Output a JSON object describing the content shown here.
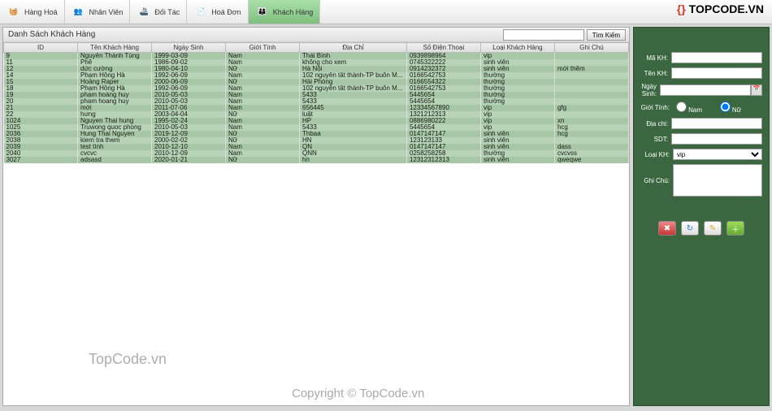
{
  "toolbar": {
    "items": [
      {
        "label": "Hàng Hoá",
        "icon": "🧺"
      },
      {
        "label": "Nhân Viên",
        "icon": "👥"
      },
      {
        "label": "Đối Tác",
        "icon": "🚢"
      },
      {
        "label": "Hoá Đơn",
        "icon": "📄"
      },
      {
        "label": "Khách Hàng",
        "icon": "👨‍👩‍👦"
      }
    ]
  },
  "logo_text": "TOPCODE.VN",
  "list_title": "Danh Sách Khách Hàng",
  "search_btn": "Tìm Kiếm",
  "columns": [
    "ID",
    "Tên Khách Hàng",
    "Ngày Sinh",
    "Giới Tính",
    "Địa Chỉ",
    "Số Điện Thoại",
    "Loại Khách Hàng",
    "Ghi Chú"
  ],
  "rows": [
    [
      "9",
      "Nguyễn Thành Tùng",
      "1999-03-09",
      "Nam",
      "Thái Bình",
      "0939898964",
      "vip",
      ""
    ],
    [
      "11",
      "Phê",
      "1986-09-02",
      "Nam",
      "không cho xem",
      "0745322222",
      "sinh viên",
      ""
    ],
    [
      "12",
      "dức cường",
      "1980-04-10",
      "Nữ",
      "Hà Nội",
      "0914232372",
      "sinh viên",
      "mới thêm"
    ],
    [
      "14",
      "Phạm Hồng Hà",
      "1992-06-09",
      "Nam",
      "102 nguyễn tất thành-TP buôn M...",
      "0166542753",
      "thường",
      ""
    ],
    [
      "15",
      "Hoàng Raper",
      "2000-06-09",
      "Nữ",
      "Hải Phòng",
      "0166554322",
      "thường",
      ""
    ],
    [
      "18",
      "Phạm Hồng Hà",
      "1992-06-09",
      "Nam",
      "102 nguyễn tất thành-TP buôn M...",
      "0166542753",
      "thường",
      ""
    ],
    [
      "19",
      "phạm hoàng huy",
      "2010-05-03",
      "Nam",
      "5433",
      "5445654",
      "thường",
      ""
    ],
    [
      "20",
      "pham hoang huy",
      "2010-05-03",
      "Nam",
      "5433",
      "5445654",
      "thường",
      ""
    ],
    [
      "21",
      "mới",
      "2011-07-06",
      "Nam",
      "656445",
      "12334567890",
      "vip",
      "gfg"
    ],
    [
      "22",
      "hưng",
      "2003-04-04",
      "Nữ",
      "luật",
      "1321212313",
      "vip",
      ""
    ],
    [
      "1024",
      "Nguyen Thai hung",
      "1995-02-24",
      "Nam",
      "HP",
      "0886980222",
      "vip",
      "xn"
    ],
    [
      "1025",
      "Truwong quoc phong",
      "2010-05-03",
      "Nam",
      "5433",
      "5445654",
      "vip",
      "hcg"
    ],
    [
      "2036",
      "Hung Thai Nguyen",
      "2019-12-09",
      "Nữ",
      "Thbaa",
      "0147147147",
      "sinh viên",
      "hcg"
    ],
    [
      "2038",
      "kiem tra them",
      "2000-02-02",
      "Nữ",
      "HN",
      "123123133",
      "sinh viên",
      ""
    ],
    [
      "2039",
      "test tính",
      "2010-12-10",
      "Nam",
      "QN",
      "0147147147",
      "sinh viên",
      "dass"
    ],
    [
      "2040",
      "cvcvc",
      "2010-12-09",
      "Nam",
      "QNN",
      "0258258258",
      "thường",
      "cvcvss"
    ],
    [
      "3027",
      "adsasd",
      "2020-01-21",
      "Nữ",
      "hn",
      "12312312313",
      "sinh viên",
      "qweqwe"
    ]
  ],
  "form": {
    "ma": "Mã KH:",
    "ten": "Tên KH:",
    "ngay": "Ngày Sinh:",
    "gioi": "Giới Tính:",
    "gioi_nam": "Nam",
    "gioi_nu": "Nữ",
    "dia": "Địa chi:",
    "sdt": "SDT:",
    "loai": "Loại KH:",
    "loai_val": "vip",
    "ghi": "Ghi Chú:"
  },
  "wm1": "TopCode.vn",
  "wm2": "Copyright © TopCode.vn"
}
